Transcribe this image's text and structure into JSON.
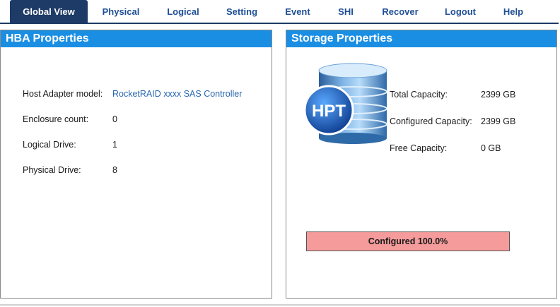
{
  "nav": {
    "items": [
      {
        "label": "Global View",
        "active": true
      },
      {
        "label": "Physical"
      },
      {
        "label": "Logical"
      },
      {
        "label": "Setting"
      },
      {
        "label": "Event"
      },
      {
        "label": "SHI"
      },
      {
        "label": "Recover"
      },
      {
        "label": "Logout"
      },
      {
        "label": "Help"
      }
    ]
  },
  "hba": {
    "title": "HBA Properties",
    "rows": [
      {
        "label": "Host Adapter model:",
        "value": "RocketRAID xxxx SAS Controller"
      },
      {
        "label": "Enclosure count:",
        "value": "0"
      },
      {
        "label": "Logical Drive:",
        "value": "1"
      },
      {
        "label": "Physical Drive:",
        "value": "8"
      }
    ]
  },
  "storage": {
    "title": "Storage Properties",
    "logo_text": "HPT",
    "rows": [
      {
        "label": "Total Capacity:",
        "value": "2399 GB"
      },
      {
        "label": "Configured Capacity:",
        "value": "2399 GB"
      },
      {
        "label": "Free Capacity:",
        "value": "0 GB"
      }
    ],
    "progress_label": "Configured 100.0%",
    "progress_fraction": 1.0
  },
  "colors": {
    "nav_active_bg": "#1d3b66",
    "nav_text": "#1f4f96",
    "panel_header_bg": "#1a8ee3",
    "progress_fill": "#f59b9b",
    "link": "#2766b0"
  },
  "icons": {
    "storage_logo": "database-icon"
  }
}
